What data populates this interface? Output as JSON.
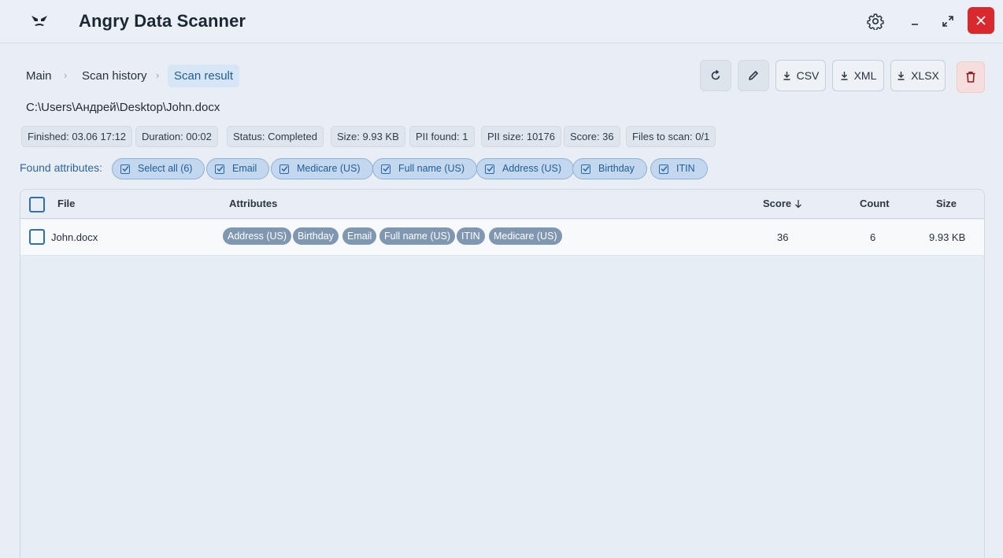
{
  "app": {
    "title": "Angry Data Scanner",
    "icons": {
      "logo": "angry-face-logo-icon",
      "settings": "gear-icon",
      "minimize": "minimize-icon",
      "maximize": "expand-icon",
      "close": "close-icon"
    },
    "colors": {
      "close": "#d9282e",
      "accent": "#1f5d98",
      "chip": "#c3d7ee",
      "tag": "#7f97b1",
      "delete_bg": "#f7dede"
    }
  },
  "breadcrumb": {
    "items": [
      "Main",
      "Scan history",
      "Scan result"
    ],
    "separator": "›"
  },
  "toolbar": {
    "refresh_icon": "refresh-icon",
    "edit_icon": "pencil-icon",
    "csv_label": "CSV",
    "xml_label": "XML",
    "xlsx_label": "XLSX",
    "download_icon": "download-icon",
    "delete_icon": "trash-icon"
  },
  "file_path": "C:\\Users\\Андрей\\Desktop\\John.docx",
  "info": {
    "finished": "Finished: 03.06 17:12",
    "duration": "Duration: 00:02",
    "status": "Status: Completed",
    "size": "Size: 9.93 KB",
    "pii_found": "PII found: 1",
    "pii_size": "PII size: 10176",
    "score": "Score: 36",
    "files_to_scan": "Files to scan: 0/1"
  },
  "found_attributes": {
    "label": "Found attributes:",
    "items": [
      "Select all (6)",
      "Email",
      "Medicare (US)",
      "Full name (US)",
      "Address (US)",
      "Birthday",
      "ITIN"
    ]
  },
  "table": {
    "columns": {
      "file": "File",
      "attributes": "Attributes",
      "score": "Score",
      "count": "Count",
      "size": "Size"
    },
    "sort_icon": "arrow-down-icon",
    "rows": [
      {
        "file": "John.docx",
        "attributes": [
          "Address (US)",
          "Birthday",
          "Email",
          "Full name (US)",
          "ITIN",
          "Medicare (US)"
        ],
        "score": "36",
        "count": "6",
        "size": "9.93 KB"
      }
    ]
  }
}
